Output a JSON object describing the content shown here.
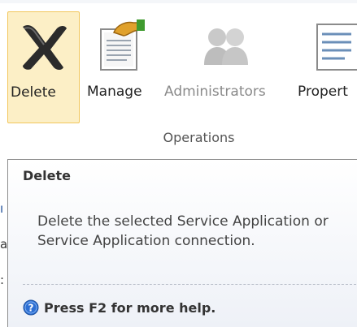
{
  "ribbon": {
    "buttons": [
      {
        "id": "delete",
        "label": "Delete",
        "icon": "delete-x-icon",
        "enabled": true,
        "highlighted": true
      },
      {
        "id": "manage",
        "label": "Manage",
        "icon": "manage-document-icon",
        "enabled": true
      },
      {
        "id": "administrators",
        "label": "Administrators",
        "icon": "administrators-icon",
        "enabled": false
      },
      {
        "id": "properties",
        "label": "Propert",
        "icon": "properties-icon",
        "enabled": true
      }
    ],
    "group_label": "Operations"
  },
  "tooltip": {
    "title": "Delete",
    "description": "Delete the selected Service Application or Service Application connection.",
    "help_text": "Press F2 for more help.",
    "help_icon": "help-question-icon"
  },
  "background_fragments": [
    "ı",
    "a",
    ":"
  ],
  "colors": {
    "highlight_fill": "#fcefc6",
    "highlight_border": "#f2c65c",
    "disabled_text": "#8a8a8a",
    "help_icon_blue": "#2d6fd3"
  }
}
